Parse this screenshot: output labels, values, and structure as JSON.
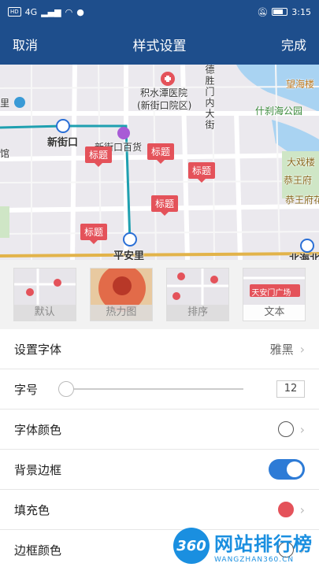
{
  "status_bar": {
    "network": "HD",
    "signal_label": "4G",
    "time": "3:15"
  },
  "header": {
    "cancel": "取消",
    "title": "样式设置",
    "done": "完成"
  },
  "map": {
    "hospital": "积水潭医院",
    "hospital_sub": "(新街口院区)",
    "street": "德胜门内大街",
    "lake_label": "望海楼",
    "park": "什刹海公园",
    "xinjiekou": "新街口",
    "baihuo": "新街口百货",
    "theater": "大戏楼",
    "gongwangfu": "恭王府",
    "gongwangfu_garden": "恭王府花园",
    "pinganli": "平安里",
    "beihai": "北海北",
    "left_li": "里",
    "left_guan": "馆",
    "marker_label": "标题"
  },
  "styles": {
    "default": "默认",
    "heat": "热力图",
    "sort": "排序",
    "text": "文本",
    "text_sample": "天安门广场"
  },
  "settings": {
    "font": {
      "label": "设置字体",
      "value": "雅黑"
    },
    "size": {
      "label": "字号",
      "value": "12"
    },
    "font_color": {
      "label": "字体颜色"
    },
    "border_bg": {
      "label": "背景边框"
    },
    "fill": {
      "label": "填充色",
      "color": "#e4525a"
    },
    "border_color": {
      "label": "边框颜色"
    }
  },
  "watermark": {
    "logo": "360",
    "cn": "网站排行榜",
    "en": "WANGZHAN360.CN"
  },
  "colors": {
    "header": "#1e4e8c",
    "toggle": "#2d7bd6",
    "marker": "#e4525a"
  }
}
